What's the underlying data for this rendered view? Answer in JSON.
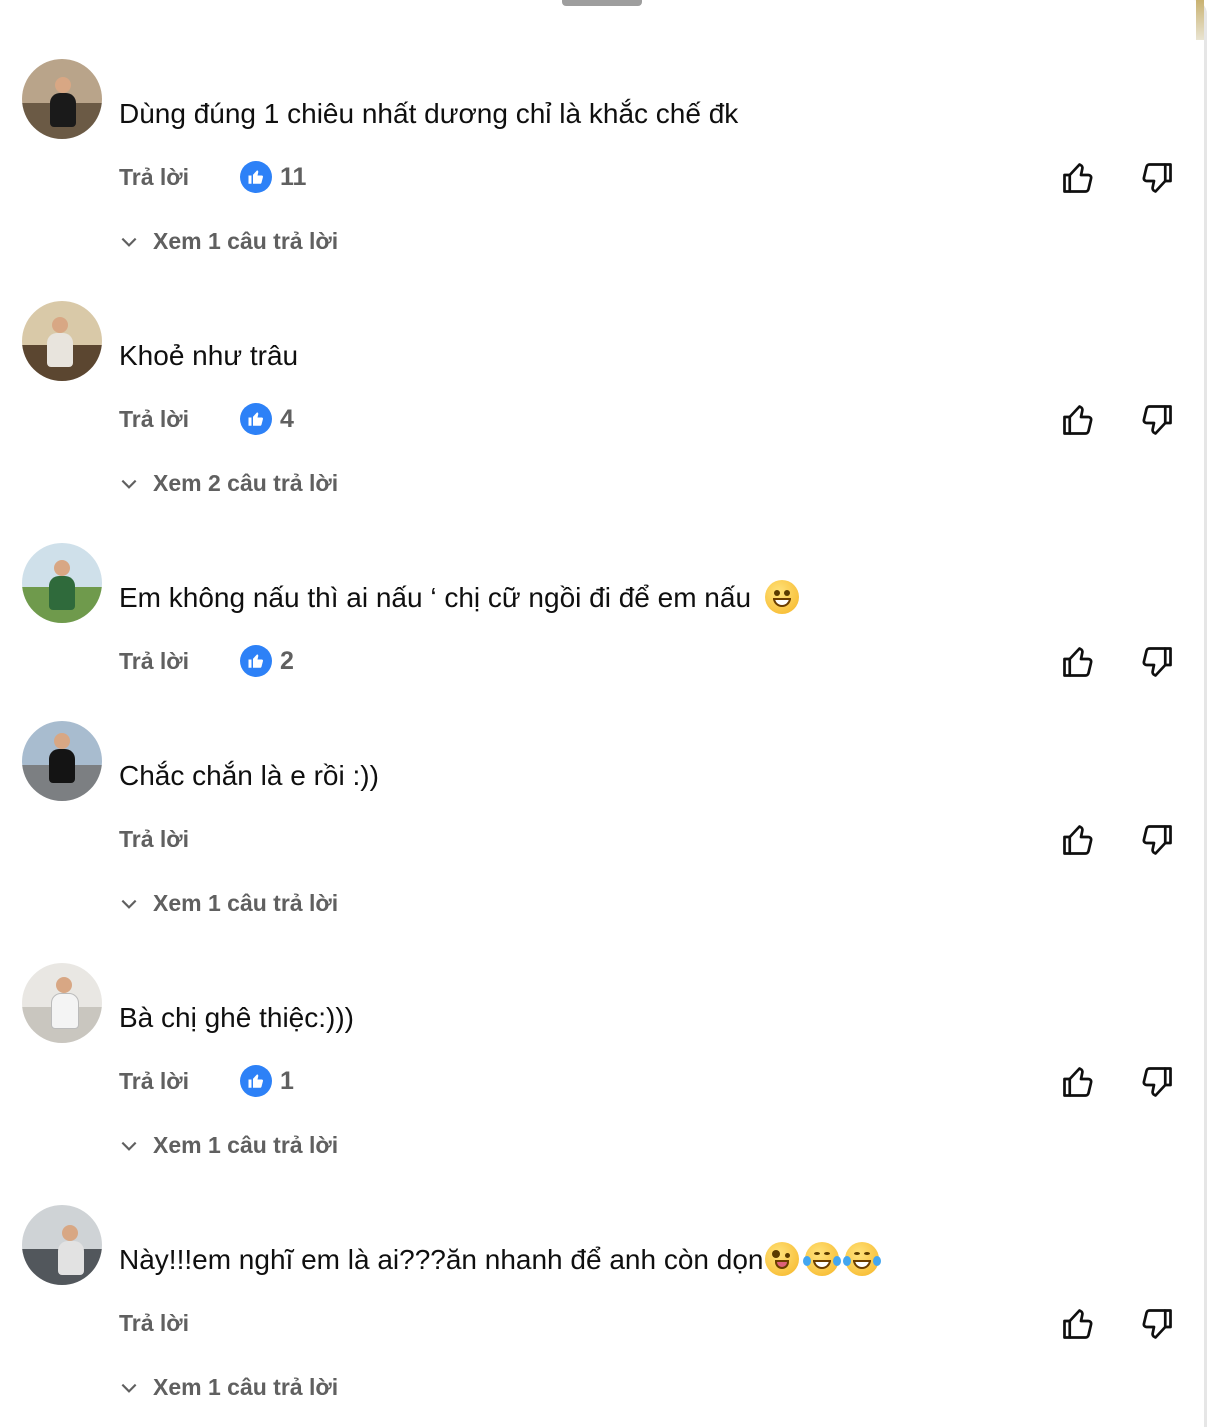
{
  "comments": [
    {
      "author": "",
      "time": "",
      "text": "Dùng đúng 1 chiêu nhất dương chỉ là khắc chế đk",
      "reply_label": "Trả lời",
      "like_count": "11",
      "view_replies": "Xem 1 câu trả lời"
    },
    {
      "author": "",
      "time": "",
      "text": "Khoẻ như trâu",
      "reply_label": "Trả lời",
      "like_count": "4",
      "view_replies": "Xem 2 câu trả lời"
    },
    {
      "author": "",
      "time": "",
      "text": "Em không nấu thì ai nấu ‘ chị cữ ngồi đi để em nấu",
      "emojis": [
        "grinning-face"
      ],
      "reply_label": "Trả lời",
      "like_count": "2",
      "view_replies": ""
    },
    {
      "author": "",
      "time": "",
      "text": "Chắc chắn là e rồi :))",
      "reply_label": "Trả lời",
      "like_count": "",
      "view_replies": "Xem 1 câu trả lời"
    },
    {
      "author": "",
      "time": "",
      "text": "Bà chị ghê thiệc:)))",
      "reply_label": "Trả lời",
      "like_count": "1",
      "view_replies": "Xem 1 câu trả lời"
    },
    {
      "author": "",
      "time": "",
      "text": "Này!!!em nghĩ em là ai???ăn nhanh để anh còn dọn",
      "emojis": [
        "zany-face",
        "tears-of-joy",
        "tears-of-joy"
      ],
      "reply_label": "Trả lời",
      "like_count": "",
      "view_replies": "Xem 1 câu trả lời"
    }
  ],
  "icons": {
    "like": "thumb-up-icon",
    "dislike": "thumb-down-icon",
    "like_badge": "thumb-up-filled-icon",
    "expand": "chevron-down-icon"
  },
  "colors": {
    "like_badge": "#2d81f7",
    "secondary_text": "#606060",
    "primary_text": "#0f0f0f"
  }
}
